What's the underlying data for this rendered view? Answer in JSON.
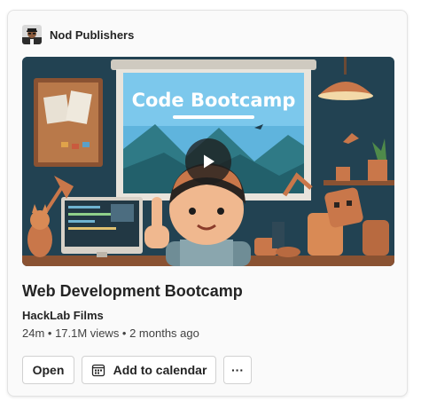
{
  "publisher": {
    "name": "Nod Publishers",
    "avatar_icon": "person-avatar-icon"
  },
  "video": {
    "thumbnail_text": "Code Bootcamp",
    "title": "Web Development Bootcamp",
    "channel": "HackLab Films",
    "meta": "24m • 17.1M views • 2 months ago",
    "play_icon": "play-icon"
  },
  "actions": {
    "open_label": "Open",
    "calendar_label": "Add to calendar",
    "calendar_icon": "calendar-icon",
    "more_label": "···",
    "more_icon": "more-horizontal-icon"
  },
  "colors": {
    "card_background": "#fafafa",
    "card_border": "#e3e3e3",
    "text_primary": "#242424",
    "text_secondary": "#424242",
    "button_border": "#d1d1d1"
  }
}
